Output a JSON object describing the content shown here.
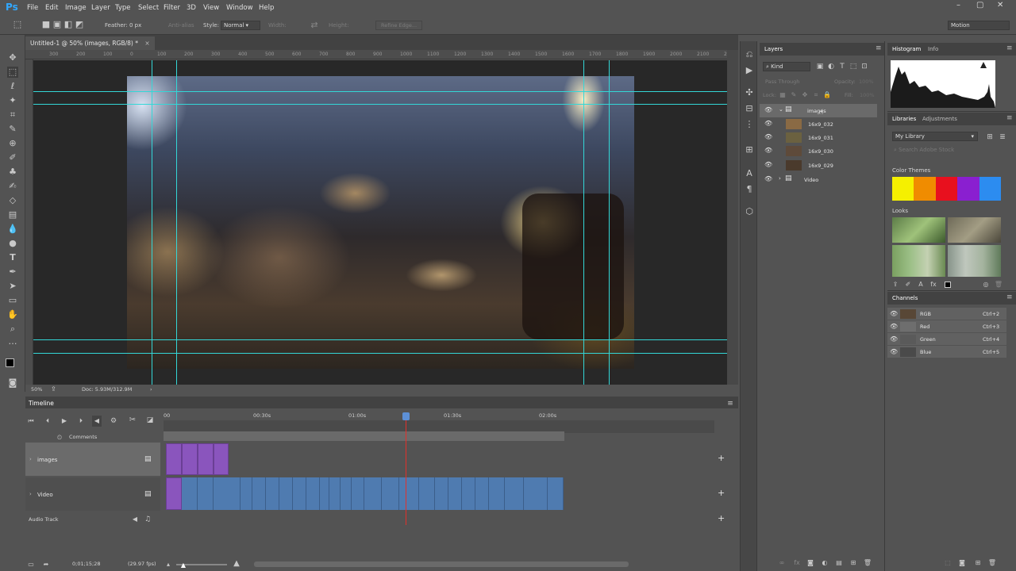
{
  "app": {
    "logo": "Ps",
    "menu": [
      "File",
      "Edit",
      "Image",
      "Layer",
      "Type",
      "Select",
      "Filter",
      "3D",
      "View",
      "Window",
      "Help"
    ],
    "workspace": "Motion"
  },
  "options": {
    "feather_label": "Feather:",
    "feather_value": "0 px",
    "antialias": "Anti-alias",
    "style_label": "Style:",
    "style_value": "Normal",
    "width_label": "Width:",
    "height_label": "Height:",
    "refine": "Refine Edge..."
  },
  "document": {
    "tab_title": "Untitled-1 @ 50% (images, RGB/8) *",
    "ruler": [
      "300",
      "200",
      "100",
      "0",
      "100",
      "200",
      "300",
      "400",
      "500",
      "600",
      "700",
      "800",
      "900",
      "1000",
      "1100",
      "1200",
      "1300",
      "1400",
      "1500",
      "1600",
      "1700",
      "1800",
      "1900",
      "2000",
      "2100",
      "2200"
    ],
    "zoom": "50%",
    "doc_size": "Doc: 5.93M/312.9M"
  },
  "timeline": {
    "title": "Timeline",
    "times": [
      "00",
      "00:30s",
      "01:00s",
      "01:30s",
      "02:00s"
    ],
    "comments": "Comments",
    "tracks": [
      "images",
      "Video"
    ],
    "audio": "Audio Track",
    "current_time": "0;01;15;28",
    "fps": "(29.97 fps)"
  },
  "layers": {
    "tab": "Layers",
    "kind": "Kind",
    "blend": "Pass Through",
    "opacity": "Opacity:",
    "opacity_value": "100%",
    "lock": "Lock:",
    "fill": "Fill:",
    "fill_value": "100%",
    "items": [
      {
        "name": "images",
        "type": "group"
      },
      {
        "name": "16x9_032",
        "type": "layer"
      },
      {
        "name": "16x9_031",
        "type": "layer"
      },
      {
        "name": "16x9_030",
        "type": "layer"
      },
      {
        "name": "16x9_029",
        "type": "layer"
      },
      {
        "name": "Video",
        "type": "group"
      }
    ]
  },
  "histogram": {
    "tabs": [
      "Histogram",
      "Info"
    ]
  },
  "libraries": {
    "tabs": [
      "Libraries",
      "Adjustments"
    ],
    "library": "My Library",
    "search_placeholder": "Search Adobe Stock",
    "color_themes": "Color Themes",
    "swatches": [
      "#f5f000",
      "#f08c00",
      "#e8101e",
      "#8a1fd0",
      "#2c8cf0"
    ],
    "looks": "Looks"
  },
  "channels": {
    "tab": "Channels",
    "items": [
      {
        "name": "RGB",
        "shortcut": "Ctrl+2"
      },
      {
        "name": "Red",
        "shortcut": "Ctrl+3"
      },
      {
        "name": "Green",
        "shortcut": "Ctrl+4"
      },
      {
        "name": "Blue",
        "shortcut": "Ctrl+5"
      }
    ]
  }
}
